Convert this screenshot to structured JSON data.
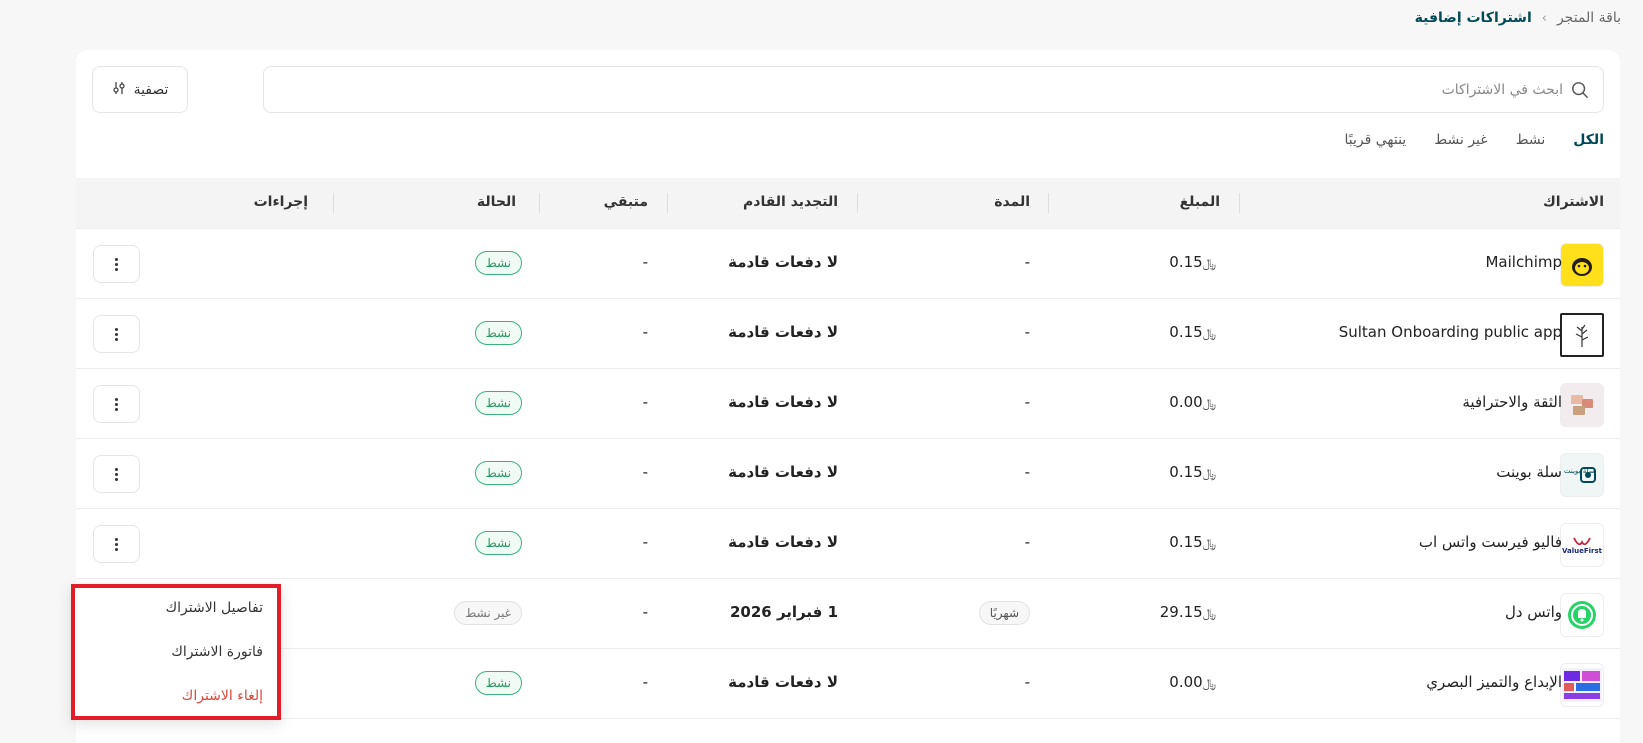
{
  "breadcrumb": {
    "parent": "باقة المتجر",
    "current": "اشتراكات إضافية"
  },
  "search": {
    "placeholder": "ابحث في الاشتراكات"
  },
  "filter": {
    "label": "تصفية"
  },
  "tabs": [
    {
      "label": "الكل",
      "active": true
    },
    {
      "label": "نشط",
      "active": false
    },
    {
      "label": "غير نشط",
      "active": false
    },
    {
      "label": "ينتهي قريبًا",
      "active": false
    }
  ],
  "table": {
    "headers": {
      "subscription": "الاشتراك",
      "amount": "المبلغ",
      "duration": "المدة",
      "next_renewal": "التجديد القادم",
      "remaining": "متبقي",
      "status": "الحالة",
      "actions": "إجراءات"
    },
    "rows": [
      {
        "name": "Mailchimp",
        "amount": "0.15",
        "currency": "﷼",
        "duration": "-",
        "next_renewal": "لا دفعات قادمة",
        "remaining": "-",
        "status": "نشط",
        "logo": "mailchimp-logo"
      },
      {
        "name": "Sultan Onboarding public app",
        "amount": "0.15",
        "currency": "﷼",
        "duration": "-",
        "next_renewal": "لا دفعات قادمة",
        "remaining": "-",
        "status": "نشط",
        "logo": "plant-logo"
      },
      {
        "name": "الثقة والاحترافية",
        "amount": "0.00",
        "currency": "﷼",
        "duration": "-",
        "next_renewal": "لا دفعات قادمة",
        "remaining": "-",
        "status": "نشط",
        "logo": "cards-logo"
      },
      {
        "name": "سلة بوينت",
        "amount": "0.15",
        "currency": "﷼",
        "duration": "-",
        "next_renewal": "لا دفعات قادمة",
        "remaining": "-",
        "status": "نشط",
        "logo": "salla-point-logo"
      },
      {
        "name": "فاليو فيرست واتس اب",
        "amount": "0.15",
        "currency": "﷼",
        "duration": "-",
        "next_renewal": "لا دفعات قادمة",
        "remaining": "-",
        "status": "نشط",
        "logo": "valuefirst-logo"
      },
      {
        "name": "واتس دل",
        "amount": "29.15",
        "currency": "﷼",
        "duration": "شهريًا",
        "next_renewal": "1 فبراير 2026",
        "remaining": "-",
        "status": "غير نشط",
        "logo": "whatsapp-bell-logo"
      },
      {
        "name": "الإبداع والتميز البصري",
        "amount": "0.00",
        "currency": "﷼",
        "duration": "-",
        "next_renewal": "لا دفعات قادمة",
        "remaining": "-",
        "status": "نشط",
        "logo": "gallery-logo"
      }
    ]
  },
  "action_menu": {
    "items": [
      {
        "label": "تفاصيل الاشتراك"
      },
      {
        "label": "فاتورة الاشتراك"
      },
      {
        "label": "إلغاء الاشتراك"
      }
    ],
    "highlight_color": "#e21d2a"
  },
  "logo_texts": {
    "salla_point": "سلة بوينت",
    "valuefirst": "ValueFirst"
  },
  "colors": {
    "accent": "#004956",
    "active_badge": "#27965f",
    "danger": "#e0463a"
  }
}
